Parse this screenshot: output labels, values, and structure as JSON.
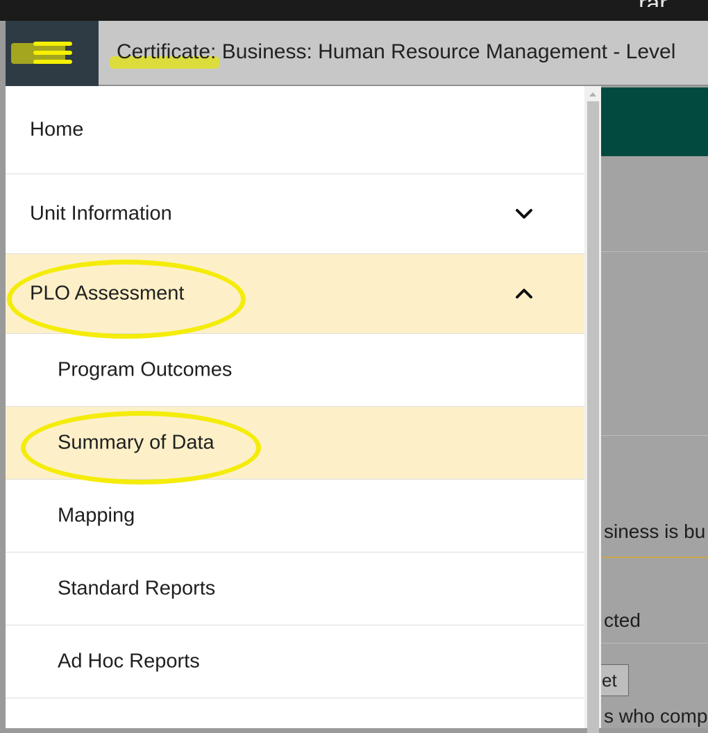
{
  "header": {
    "top_peek_text": "rar",
    "title": "Certificate: Business: Human Resource Management - Level"
  },
  "menu": {
    "items": [
      {
        "label": "Home",
        "level": "top"
      },
      {
        "label": "Unit Information",
        "level": "top",
        "chevron": "chevron-down-icon"
      },
      {
        "label": "PLO Assessment",
        "level": "top",
        "chevron": "chevron-up-icon",
        "active": true
      },
      {
        "label": "Program Outcomes",
        "level": "sub"
      },
      {
        "label": "Summary of Data",
        "level": "sub",
        "active": true
      },
      {
        "label": "Mapping",
        "level": "sub"
      },
      {
        "label": "Standard Reports",
        "level": "sub"
      },
      {
        "label": "Ad Hoc Reports",
        "level": "sub"
      }
    ]
  },
  "background_peek": {
    "text_1": "siness is bu",
    "text_2": "cted",
    "button": "et",
    "text_3": "s who comp"
  },
  "colors": {
    "active_row": "#fdf0c9",
    "highlighter": "#f4ec0a",
    "teal_band": "#024a40",
    "header_bar": "#c7c7c7"
  }
}
